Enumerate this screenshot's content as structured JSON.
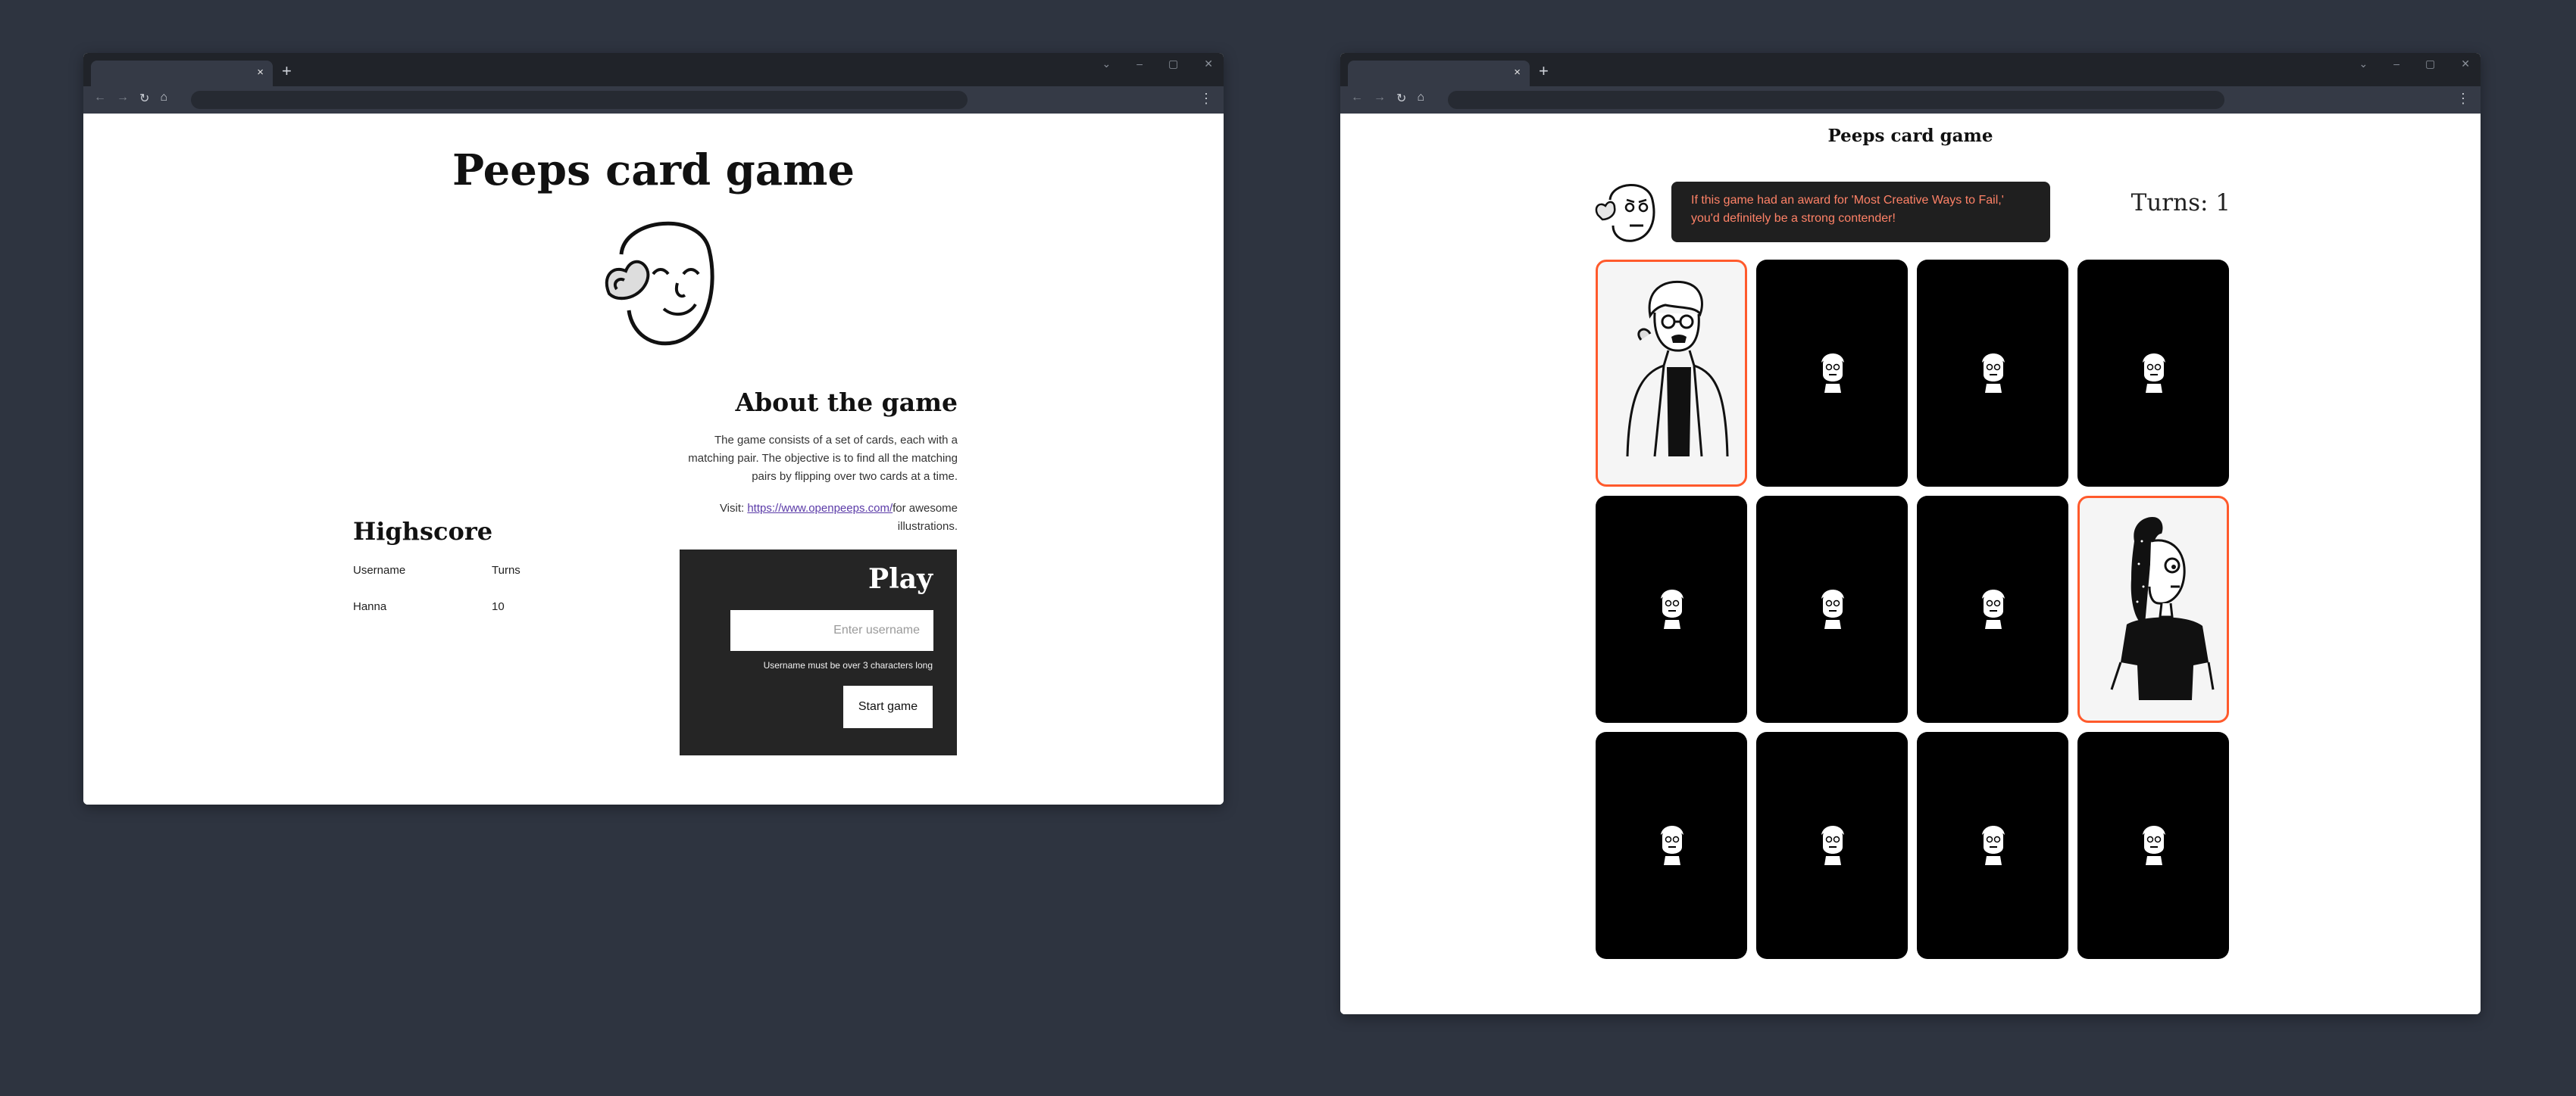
{
  "window1": {
    "tab_close": "×",
    "new_tab": "+",
    "title": "Peeps card game",
    "about": {
      "heading": "About the game",
      "text": "The game consists of a set of cards, each with a matching pair. The objective is to find all the matching pairs by flipping over two cards at a time.",
      "visit_prefix": "Visit: ",
      "link_text": "https://www.openpeeps.com/",
      "visit_suffix": "for awesome illustrations."
    },
    "highscore": {
      "heading": "Highscore",
      "columns": [
        "Username",
        "Turns"
      ],
      "rows": [
        {
          "username": "Hanna",
          "turns": "10"
        }
      ]
    },
    "play": {
      "heading": "Play",
      "username_placeholder": "Enter username",
      "hint": "Username must be over 3 characters long",
      "start_label": "Start game"
    }
  },
  "window2": {
    "tab_close": "×",
    "new_tab": "+",
    "title": "Peeps card game",
    "quote": "If this game had an award for 'Most Creative Ways to Fail,' you'd definitely be a strong contender!",
    "turns_label": "Turns: 1",
    "cards": [
      {
        "state": "face-up",
        "peep": "glasses-man"
      },
      {
        "state": "face-down"
      },
      {
        "state": "face-down"
      },
      {
        "state": "face-down"
      },
      {
        "state": "face-down"
      },
      {
        "state": "face-down"
      },
      {
        "state": "face-down"
      },
      {
        "state": "face-up",
        "peep": "ponytail-woman"
      },
      {
        "state": "face-down"
      },
      {
        "state": "face-down"
      },
      {
        "state": "face-down"
      },
      {
        "state": "face-down"
      }
    ]
  },
  "colors": {
    "desktop": "#2e3440",
    "accent_border": "#ff5a2c",
    "quote_text": "#ff8267",
    "play_panel": "#252525"
  }
}
